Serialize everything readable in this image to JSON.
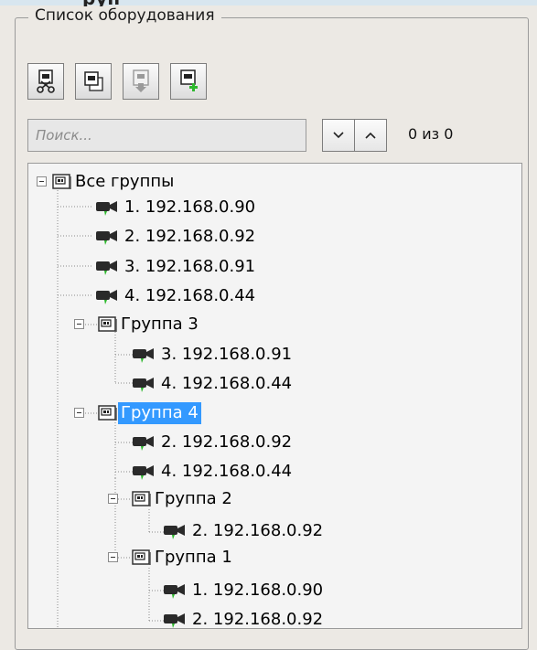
{
  "window": {
    "top_clipped_text": "руп"
  },
  "equipment_panel": {
    "title": "Список оборудования",
    "toolbar": [
      {
        "name": "remove-camera-button",
        "icon": "camera-cut-icon"
      },
      {
        "name": "copy-camera-button",
        "icon": "camera-copy-icon"
      },
      {
        "name": "move-camera-button",
        "icon": "camera-move-down-icon"
      },
      {
        "name": "add-camera-button",
        "icon": "camera-add-icon"
      }
    ],
    "search": {
      "placeholder": "Поиск...",
      "value": ""
    },
    "navigation": {
      "down_icon": "chevron-down-icon",
      "up_icon": "chevron-up-icon",
      "counter": "0 из 0"
    },
    "tree": {
      "root": {
        "label": "Все группы",
        "cameras": [
          "1. 192.168.0.90",
          "2. 192.168.0.92",
          "3. 192.168.0.91",
          "4. 192.168.0.44"
        ],
        "groups": [
          {
            "label": "Группа 3",
            "cameras": [
              "3. 192.168.0.91",
              "4. 192.168.0.44"
            ]
          },
          {
            "label": "Группа 4",
            "selected": true,
            "cameras": [
              "2. 192.168.0.92",
              "4. 192.168.0.44"
            ],
            "groups": [
              {
                "label": "Группа 2",
                "cameras": [
                  "2. 192.168.0.92"
                ]
              },
              {
                "label": "Группа 1",
                "cameras": [
                  "1. 192.168.0.90",
                  "2. 192.168.0.92"
                ]
              }
            ]
          }
        ]
      }
    }
  },
  "colors": {
    "selection": "#3399ff",
    "camera_green": "#2db82d"
  }
}
